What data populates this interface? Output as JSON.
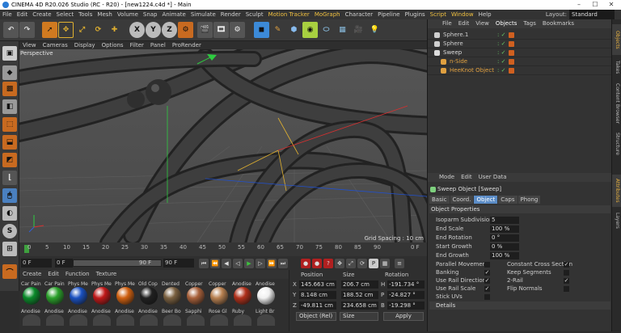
{
  "window": {
    "title": "CINEMA 4D R20.026 Studio (RC - R20) - [new1224.c4d *] - Main",
    "controls": [
      "–",
      "☐",
      "✕"
    ]
  },
  "menu": [
    "File",
    "Edit",
    "Create",
    "Select",
    "Tools",
    "Mesh",
    "Volume",
    "Snap",
    "Animate",
    "Simulate",
    "Render",
    "Sculpt",
    "Motion Tracker",
    "MoGraph",
    "Character",
    "Pipeline",
    "Plugins",
    "Script",
    "Window",
    "Help"
  ],
  "layout": {
    "label": "Layout:",
    "value": "Standard"
  },
  "toolbar_letters": [
    "X",
    "Y",
    "Z"
  ],
  "viewport": {
    "menu": [
      "View",
      "Cameras",
      "Display",
      "Options",
      "Filter",
      "Panel",
      "ProRender"
    ],
    "label": "Perspective",
    "grid_spacing": "Grid Spacing : 10 cm"
  },
  "timeline": {
    "ticks": [
      "0",
      "5",
      "10",
      "15",
      "20",
      "25",
      "30",
      "35",
      "40",
      "45",
      "50",
      "55",
      "60",
      "65",
      "70",
      "75",
      "80",
      "85",
      "90"
    ],
    "end_label": "0 F"
  },
  "playback": {
    "current": "0 F",
    "start": "0 F",
    "end": "90 F",
    "end2": "90 F"
  },
  "materials": {
    "menu": [
      "Create",
      "Edit",
      "Function",
      "Texture"
    ],
    "row1": [
      {
        "name": "Car Pain",
        "color": "#0a8a2a"
      },
      {
        "name": "Car Pain",
        "color": "#2aa02a"
      },
      {
        "name": "Phys Me",
        "color": "#1a50c0"
      },
      {
        "name": "Phys Me",
        "color": "#c01818"
      },
      {
        "name": "Phys Me",
        "color": "#d06010"
      },
      {
        "name": "Old Cop",
        "color": "#202020"
      },
      {
        "name": "Dented",
        "color": "#7a6040"
      },
      {
        "name": "Copper",
        "color": "#a8603a"
      },
      {
        "name": "Copper",
        "color": "#b88050"
      },
      {
        "name": "Anodise",
        "color": "#b0301a"
      },
      {
        "name": "Anodise",
        "color": "#f0f0f0"
      }
    ],
    "row2": [
      "Anodise",
      "Anodise",
      "Anodise",
      "Anodise",
      "Anodise",
      "Anodise",
      "Beer Bo",
      "Sapphi",
      "Rose Gl",
      "Ruby",
      "Light Br"
    ]
  },
  "coords": {
    "headers": [
      "Position",
      "Size",
      "Rotation"
    ],
    "rows": [
      {
        "axis": "X",
        "pos": "145.663 cm",
        "size": "206.7 cm",
        "rlab": "H",
        "rot": "-191.734 °"
      },
      {
        "axis": "Y",
        "pos": "8.148 cm",
        "size": "188.52 cm",
        "rlab": "P",
        "rot": "-24.827 °"
      },
      {
        "axis": "Z",
        "pos": "-49.811 cm",
        "size": "234.658 cm",
        "rlab": "B",
        "rot": "-19.298 °"
      }
    ],
    "mode": "Object (Rel)",
    "size_mode": "Size",
    "apply": "Apply"
  },
  "objects": {
    "tabs": [
      "File",
      "Edit",
      "View",
      "Objects",
      "Tags",
      "Bookmarks"
    ],
    "items": [
      {
        "name": "Sphere.1",
        "color": "#cfcfcf",
        "indent": 0
      },
      {
        "name": "Sphere",
        "color": "#cfcfcf",
        "indent": 0
      },
      {
        "name": "Sweep",
        "color": "#dddddd",
        "indent": 0
      },
      {
        "name": "n-Side",
        "color": "#e0a040",
        "indent": 1
      },
      {
        "name": "HeeKnot Object",
        "color": "#e0a040",
        "indent": 1
      }
    ]
  },
  "attributes": {
    "menu": [
      "Mode",
      "Edit",
      "User Data"
    ],
    "title": "Sweep Object [Sweep]",
    "tabs": [
      "Basic",
      "Coord.",
      "Object",
      "Caps",
      "Phong"
    ],
    "section": "Object Properties",
    "props": [
      {
        "label": "Isoparm Subdivision",
        "value": "5"
      },
      {
        "label": "End Scale",
        "value": "100 %"
      },
      {
        "label": "End Rotation",
        "value": "0 °"
      },
      {
        "label": "Start Growth",
        "value": "0 %"
      },
      {
        "label": "End Growth",
        "value": "100 %"
      }
    ],
    "checks_left": [
      {
        "label": "Parallel Movement",
        "value": ""
      },
      {
        "label": "Banking",
        "value": "✓"
      },
      {
        "label": "Use Rail Direction",
        "value": "✓"
      },
      {
        "label": "Use Rail Scale",
        "value": "✓"
      },
      {
        "label": "Stick UVs",
        "value": ""
      }
    ],
    "checks_right": [
      {
        "label": "Constant Cross Section",
        "value": "✓"
      },
      {
        "label": "Keep Segments",
        "value": ""
      },
      {
        "label": "2-Rail",
        "value": "✓"
      },
      {
        "label": "Flip Normals",
        "value": ""
      }
    ],
    "details": "Details"
  },
  "side_tabs": [
    "Objects",
    "Takes",
    "Content Browser",
    "Structure",
    "Attributes",
    "Layers"
  ]
}
